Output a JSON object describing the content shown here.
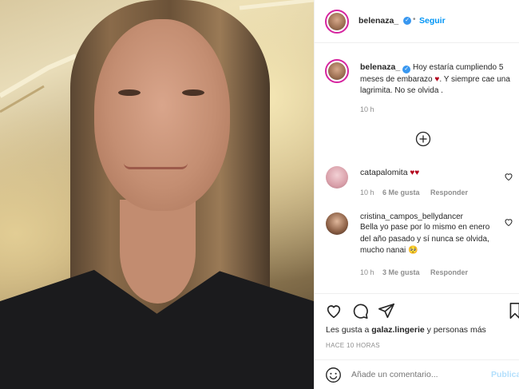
{
  "post": {
    "username": "belenaza_",
    "follow_label": "Seguir",
    "caption": "Hoy estaría cumpliendo 5 meses de embarazo",
    "caption_heart": "♥",
    "caption_tail": ". Y siempre cae una lagrimita. No se olvida .",
    "caption_time": "10 h"
  },
  "comments": [
    {
      "username": "catapalomita",
      "text": "♥♥",
      "time": "10 h",
      "likes": "6 Me gusta",
      "reply": "Responder"
    },
    {
      "username": "cristina_campos_bellydancer",
      "text": "Bella yo pase por lo mismo en enero del año pasado y sí nunca se olvida, mucho nanai 🥺",
      "time": "10 h",
      "likes": "3 Me gusta",
      "reply": "Responder"
    }
  ],
  "likes": {
    "prefix": "Les gusta a",
    "user": "galaz.lingerie",
    "suffix": "y personas más"
  },
  "timestamp": "HACE 10 HORAS",
  "composer": {
    "placeholder": "Añade un comentario...",
    "publish_label": "Publicar"
  },
  "colors": {
    "accent": "#0095f6",
    "verified": "#3897f0",
    "heart": "#b3001b",
    "text": "#262626",
    "muted": "#8e8e8e"
  }
}
